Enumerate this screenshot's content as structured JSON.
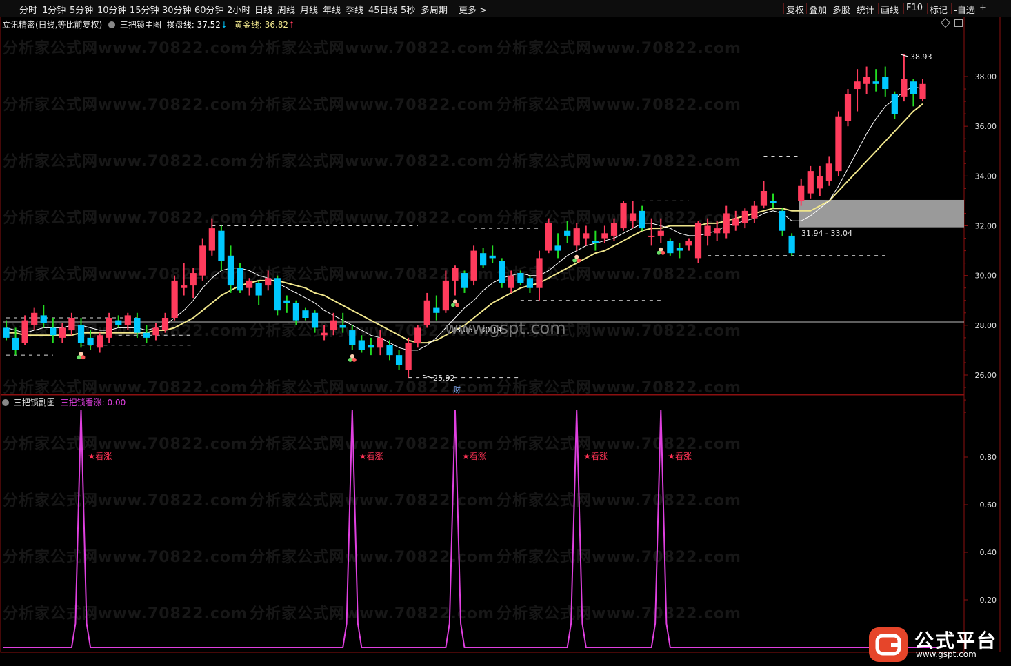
{
  "toolbar": {
    "periods": [
      "分时",
      "1分钟",
      "5分钟",
      "10分钟",
      "15分钟",
      "30分钟",
      "60分钟",
      "2小时",
      "日线",
      "周线",
      "月线",
      "年线",
      "季线",
      "45日线",
      "5秒",
      "多周期",
      "更多 >"
    ],
    "actions": [
      "复权",
      "叠加",
      "多股",
      "统计",
      "画线",
      "F10",
      "标记",
      "-自选",
      "+"
    ]
  },
  "main_panel": {
    "title": "立讯精密(日线,等比前复权)",
    "indicator_name": "三把锁主图",
    "line1_label": "操盘线:",
    "line1_value": "37.52",
    "line1_arrow": "↓",
    "line2_label": "黄金线:",
    "line2_value": "36.82",
    "line2_arrow": "↑",
    "high_label": "38.93",
    "low_label": "25.92",
    "box_label": "31.94 - 33.04",
    "mid_label": "28.06 - 30.14",
    "cai_label": "财",
    "watermark_site": "www.gspt.com"
  },
  "sub_panel": {
    "title": "三把锁副图",
    "indicator_label": "三把锁看涨: 0.00",
    "signal_label": "★看涨"
  },
  "watermark_text": "分析家公式网www.70822.com",
  "logo": {
    "text": "公式平台",
    "url": "www.gspt.com"
  },
  "colors": {
    "up": "#ff3b5c",
    "down": "#00c8ff",
    "ma_white": "#ffffff",
    "ma_yellow": "#f0e68c",
    "signal": "#e040e0",
    "frame": "#8b1010"
  },
  "chart_data": {
    "type": "candlestick",
    "ylim_main": [
      25.5,
      39.5
    ],
    "y_ticks_main": [
      "38.00",
      "36.00",
      "34.00",
      "32.00",
      "30.00",
      "28.00",
      "26.00"
    ],
    "y_ticks_sub": [
      "0.80",
      "0.60",
      "0.40",
      "0.20"
    ],
    "ylim_sub": [
      0,
      1.0
    ],
    "candles": [
      [
        27.9,
        28.2,
        27.4,
        27.5
      ],
      [
        27.5,
        27.9,
        26.8,
        27.0
      ],
      [
        27.3,
        28.4,
        27.2,
        28.2
      ],
      [
        28.0,
        28.7,
        27.8,
        28.5
      ],
      [
        28.4,
        28.8,
        27.9,
        28.1
      ],
      [
        27.9,
        28.3,
        27.3,
        27.6
      ],
      [
        27.5,
        28.1,
        27.3,
        27.9
      ],
      [
        27.8,
        28.5,
        27.6,
        28.3
      ],
      [
        28.0,
        28.3,
        27.1,
        27.3
      ],
      [
        27.5,
        27.8,
        27.0,
        27.2
      ],
      [
        27.1,
        27.7,
        26.9,
        27.6
      ],
      [
        27.5,
        28.5,
        27.3,
        28.3
      ],
      [
        28.2,
        28.4,
        27.9,
        28.0
      ],
      [
        28.0,
        28.5,
        27.8,
        28.4
      ],
      [
        28.3,
        28.5,
        27.5,
        27.7
      ],
      [
        27.7,
        28.0,
        27.3,
        27.5
      ],
      [
        27.6,
        28.1,
        27.4,
        27.9
      ],
      [
        27.8,
        28.5,
        27.7,
        28.3
      ],
      [
        28.3,
        30.0,
        28.2,
        29.8
      ],
      [
        29.5,
        30.5,
        29.2,
        29.6
      ],
      [
        29.6,
        30.3,
        29.1,
        30.1
      ],
      [
        30.0,
        31.5,
        29.8,
        31.2
      ],
      [
        31.0,
        32.3,
        30.8,
        31.9
      ],
      [
        31.8,
        32.0,
        30.2,
        30.6
      ],
      [
        30.8,
        31.2,
        29.3,
        29.6
      ],
      [
        30.3,
        30.5,
        29.3,
        29.4
      ],
      [
        29.5,
        29.9,
        29.2,
        29.8
      ],
      [
        29.7,
        29.8,
        28.8,
        29.2
      ],
      [
        29.6,
        30.2,
        29.4,
        29.9
      ],
      [
        29.9,
        30.0,
        28.4,
        28.6
      ],
      [
        29.0,
        29.2,
        28.5,
        28.9
      ],
      [
        28.9,
        29.0,
        28.0,
        28.2
      ],
      [
        28.6,
        28.7,
        28.2,
        28.3
      ],
      [
        28.5,
        28.6,
        27.7,
        27.9
      ],
      [
        27.6,
        28.0,
        27.4,
        27.7
      ],
      [
        27.8,
        28.5,
        27.6,
        28.2
      ],
      [
        28.0,
        28.5,
        27.7,
        27.9
      ],
      [
        27.8,
        28.0,
        27.0,
        27.2
      ],
      [
        27.4,
        27.6,
        26.9,
        27.0
      ],
      [
        27.2,
        27.5,
        26.8,
        27.1
      ],
      [
        27.1,
        27.8,
        26.8,
        27.5
      ],
      [
        27.2,
        27.4,
        26.6,
        26.8
      ],
      [
        26.8,
        27.0,
        26.2,
        26.4
      ],
      [
        26.2,
        27.5,
        25.9,
        27.3
      ],
      [
        27.3,
        28.0,
        27.1,
        27.9
      ],
      [
        28.0,
        29.3,
        27.9,
        29.0
      ],
      [
        28.7,
        29.2,
        28.2,
        28.5
      ],
      [
        28.6,
        30.2,
        28.5,
        29.8
      ],
      [
        29.8,
        30.4,
        29.2,
        30.3
      ],
      [
        30.1,
        30.2,
        29.3,
        29.5
      ],
      [
        29.8,
        31.2,
        29.6,
        31.0
      ],
      [
        30.9,
        31.1,
        30.3,
        30.4
      ],
      [
        30.8,
        31.2,
        30.5,
        30.7
      ],
      [
        30.6,
        30.7,
        29.5,
        29.7
      ],
      [
        29.5,
        30.2,
        29.3,
        30.0
      ],
      [
        30.1,
        30.2,
        29.6,
        29.7
      ],
      [
        29.9,
        30.0,
        29.3,
        29.5
      ],
      [
        29.5,
        31.0,
        29.0,
        30.7
      ],
      [
        31.0,
        32.3,
        30.9,
        32.1
      ],
      [
        31.2,
        31.7,
        30.7,
        31.0
      ],
      [
        31.8,
        32.2,
        31.3,
        31.6
      ],
      [
        31.2,
        32.1,
        31.0,
        31.9
      ],
      [
        31.5,
        32.0,
        31.2,
        31.7
      ],
      [
        31.4,
        31.8,
        31.0,
        31.3
      ],
      [
        31.5,
        32.0,
        31.3,
        31.7
      ],
      [
        31.6,
        32.3,
        31.4,
        32.1
      ],
      [
        31.9,
        33.0,
        31.8,
        32.9
      ],
      [
        32.2,
        33.0,
        31.9,
        32.5
      ],
      [
        32.6,
        32.8,
        31.8,
        31.9
      ],
      [
        31.6,
        32.3,
        31.2,
        31.6
      ],
      [
        31.6,
        32.3,
        31.3,
        31.8
      ],
      [
        31.4,
        31.5,
        30.8,
        30.9
      ],
      [
        31.1,
        31.3,
        30.7,
        31.0
      ],
      [
        31.2,
        31.5,
        31.0,
        31.4
      ],
      [
        30.7,
        32.2,
        30.5,
        32.1
      ],
      [
        31.6,
        32.3,
        31.2,
        32.0
      ],
      [
        31.7,
        32.2,
        31.4,
        31.9
      ],
      [
        31.7,
        32.8,
        31.5,
        32.5
      ],
      [
        32.0,
        32.6,
        31.8,
        32.3
      ],
      [
        32.1,
        32.7,
        31.9,
        32.6
      ],
      [
        32.3,
        33.0,
        32.1,
        32.8
      ],
      [
        32.8,
        33.8,
        32.7,
        33.4
      ],
      [
        33.0,
        33.3,
        32.7,
        32.9
      ],
      [
        32.6,
        32.7,
        31.6,
        31.8
      ],
      [
        31.6,
        31.7,
        30.8,
        30.9
      ],
      [
        33.0,
        33.9,
        32.8,
        33.6
      ],
      [
        33.3,
        34.4,
        33.1,
        34.2
      ],
      [
        33.5,
        34.4,
        33.2,
        34.0
      ],
      [
        33.8,
        34.8,
        33.6,
        34.5
      ],
      [
        34.2,
        36.6,
        34.0,
        36.4
      ],
      [
        36.2,
        37.5,
        36.0,
        37.3
      ],
      [
        37.5,
        38.3,
        36.6,
        37.8
      ],
      [
        37.7,
        38.4,
        37.3,
        38.0
      ],
      [
        37.8,
        38.3,
        37.4,
        37.7
      ],
      [
        38.0,
        38.4,
        37.2,
        37.5
      ],
      [
        37.3,
        37.4,
        36.3,
        36.5
      ],
      [
        37.2,
        38.9,
        37.0,
        37.9
      ],
      [
        37.8,
        37.9,
        36.8,
        37.3
      ],
      [
        37.1,
        37.9,
        37.0,
        37.7
      ]
    ],
    "ma_white": [
      27.9,
      27.8,
      27.7,
      27.8,
      27.9,
      27.9,
      27.9,
      28.0,
      28.0,
      27.9,
      27.8,
      27.8,
      27.9,
      27.9,
      27.9,
      27.8,
      27.9,
      28.0,
      28.3,
      28.6,
      29.0,
      29.5,
      29.9,
      30.2,
      30.3,
      30.3,
      30.2,
      30.0,
      29.9,
      29.7,
      29.5,
      29.3,
      29.1,
      28.9,
      28.6,
      28.4,
      28.2,
      28.0,
      27.8,
      27.6,
      27.5,
      27.3,
      27.1,
      27.0,
      27.0,
      27.2,
      27.5,
      27.9,
      28.3,
      28.7,
      29.0,
      29.4,
      29.7,
      29.9,
      30.0,
      30.1,
      30.0,
      30.0,
      30.2,
      30.5,
      30.8,
      31.0,
      31.2,
      31.3,
      31.4,
      31.5,
      31.7,
      31.9,
      32.1,
      32.1,
      32.0,
      31.9,
      31.7,
      31.6,
      31.6,
      31.7,
      31.8,
      32.0,
      32.1,
      32.2,
      32.3,
      32.5,
      32.6,
      32.5,
      32.2,
      32.2,
      32.4,
      32.7,
      33.0,
      33.6,
      34.3,
      35.0,
      35.7,
      36.3,
      36.8,
      37.1,
      37.4,
      37.6,
      37.5
    ],
    "ma_yellow": [
      27.7,
      27.7,
      27.6,
      27.6,
      27.6,
      27.6,
      27.6,
      27.6,
      27.7,
      27.7,
      27.7,
      27.7,
      27.7,
      27.7,
      27.7,
      27.7,
      27.8,
      27.8,
      27.9,
      28.1,
      28.3,
      28.6,
      28.9,
      29.2,
      29.4,
      29.6,
      29.7,
      29.8,
      29.8,
      29.8,
      29.7,
      29.6,
      29.5,
      29.3,
      29.2,
      29.0,
      28.8,
      28.6,
      28.4,
      28.2,
      28.0,
      27.8,
      27.6,
      27.4,
      27.3,
      27.3,
      27.4,
      27.6,
      27.8,
      28.0,
      28.3,
      28.6,
      28.9,
      29.1,
      29.3,
      29.5,
      29.6,
      29.7,
      29.9,
      30.1,
      30.3,
      30.5,
      30.7,
      30.9,
      31.0,
      31.2,
      31.4,
      31.6,
      31.8,
      31.9,
      31.9,
      32.0,
      32.0,
      32.0,
      32.0,
      32.1,
      32.1,
      32.2,
      32.3,
      32.4,
      32.5,
      32.6,
      32.7,
      32.7,
      32.6,
      32.6,
      32.6,
      32.8,
      33.0,
      33.4,
      33.8,
      34.2,
      34.6,
      35.0,
      35.4,
      35.8,
      36.2,
      36.6,
      36.9
    ],
    "signal_indices": [
      8,
      37,
      48,
      61,
      70
    ]
  }
}
